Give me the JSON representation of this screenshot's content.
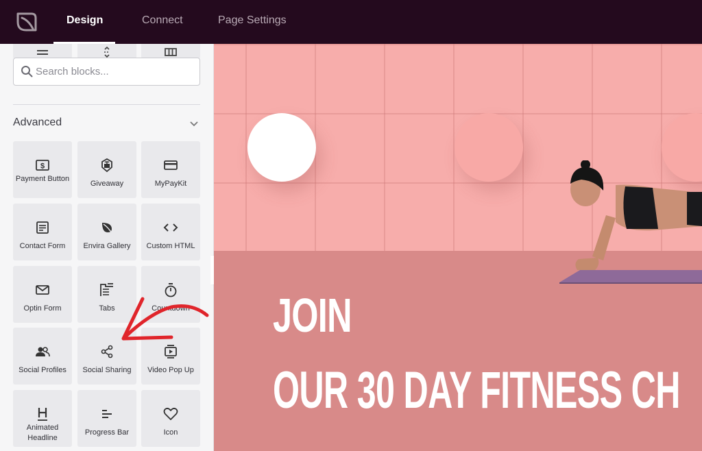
{
  "topbar": {
    "tabs": [
      {
        "label": "Design",
        "active": true
      },
      {
        "label": "Connect",
        "active": false
      },
      {
        "label": "Page Settings",
        "active": false
      }
    ]
  },
  "sidebar": {
    "search": {
      "placeholder": "Search blocks..."
    },
    "section_title": "Advanced",
    "blocks": [
      {
        "label": "Payment Button",
        "icon": "dollar-icon"
      },
      {
        "label": "Giveaway",
        "icon": "gift-badge-icon"
      },
      {
        "label": "MyPayKit",
        "icon": "credit-card-icon"
      },
      {
        "label": "Contact Form",
        "icon": "form-icon"
      },
      {
        "label": "Envira Gallery",
        "icon": "leaf-icon"
      },
      {
        "label": "Custom HTML",
        "icon": "code-icon"
      },
      {
        "label": "Optin Form",
        "icon": "envelope-icon"
      },
      {
        "label": "Tabs",
        "icon": "tabs-icon"
      },
      {
        "label": "Countdown",
        "icon": "stopwatch-icon"
      },
      {
        "label": "Social Profiles",
        "icon": "users-icon"
      },
      {
        "label": "Social Sharing",
        "icon": "share-icon"
      },
      {
        "label": "Video Pop Up",
        "icon": "video-popup-icon"
      },
      {
        "label": "Animated Headline",
        "icon": "heading-icon"
      },
      {
        "label": "Progress Bar",
        "icon": "progress-bars-icon"
      },
      {
        "label": "Icon",
        "icon": "heart-icon"
      }
    ]
  },
  "canvas": {
    "headline_line1": "JOIN",
    "headline_line2": "OUR 30 DAY FITNESS CH"
  },
  "colors": {
    "topbar_bg": "#240a1e",
    "canvas_tiles": "#f7adab",
    "canvas_lower": "#d88a89",
    "annotation_arrow": "#e0252b"
  }
}
